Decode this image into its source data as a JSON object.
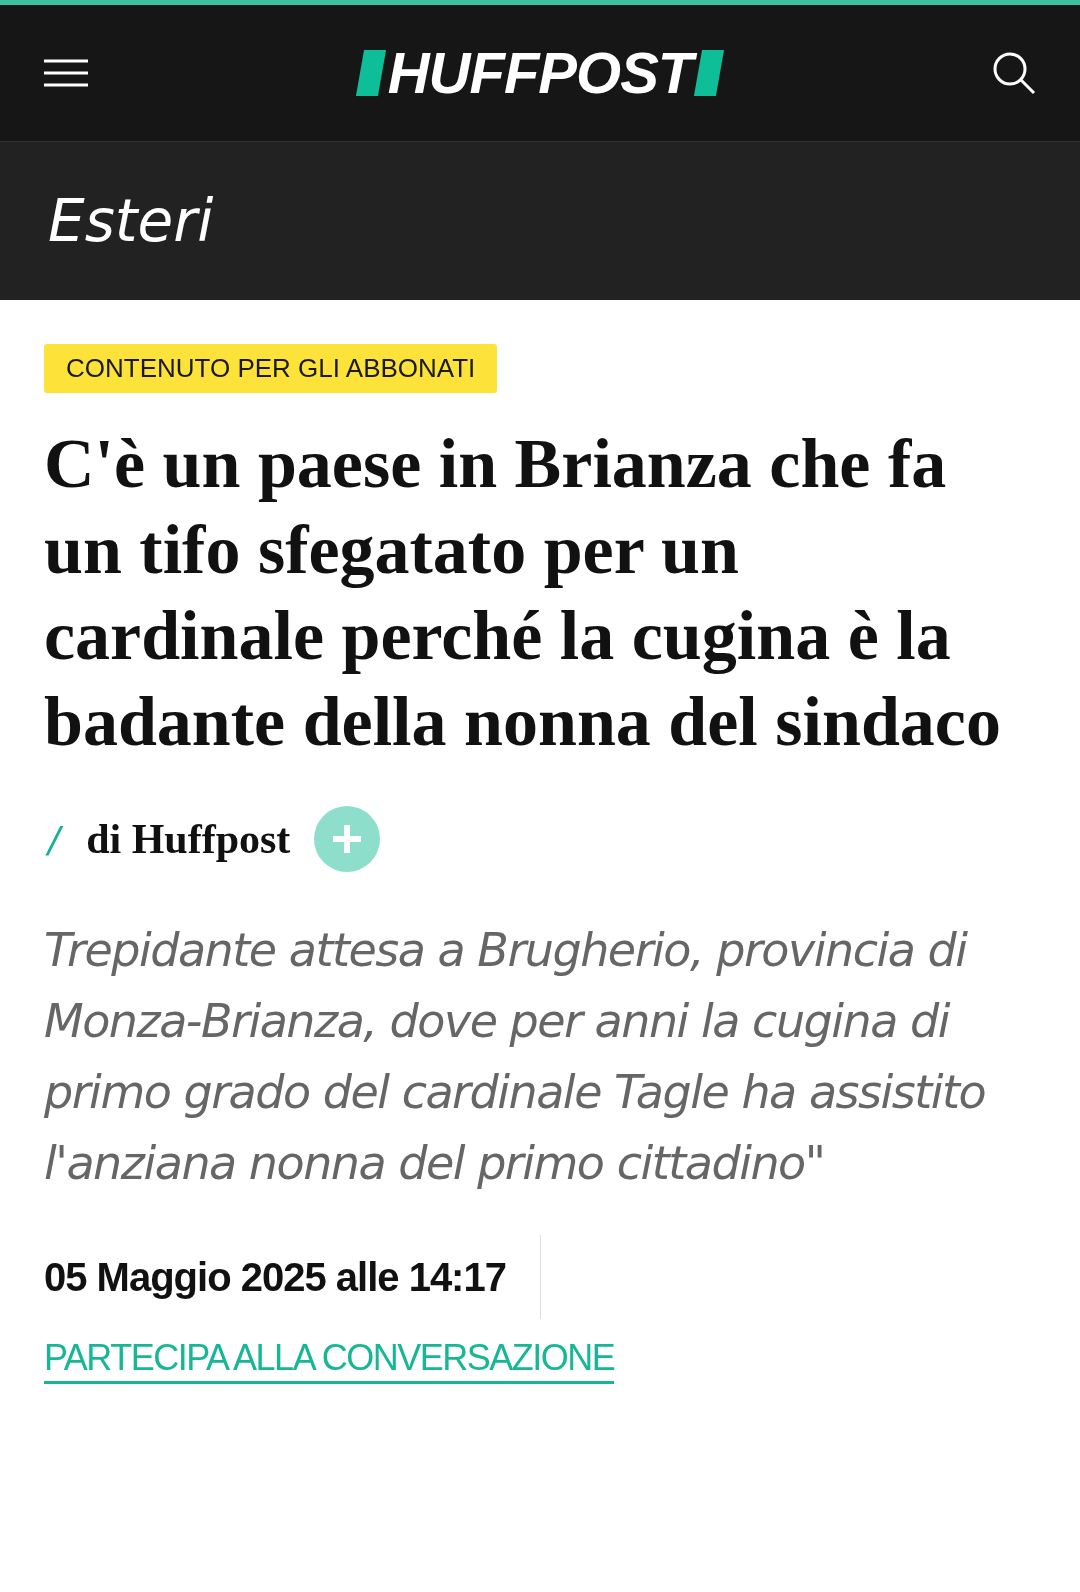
{
  "header": {
    "logo": "HUFFPOST"
  },
  "section": {
    "title": "Esteri"
  },
  "article": {
    "badge": "CONTENUTO PER GLI ABBONATI",
    "headline": "C'è un paese in Brianza che fa un tifo sfegatato per un cardinale perché la cugina è la badante della nonna del sindaco",
    "byline": {
      "separator": "/",
      "author": "di Huffpost"
    },
    "deck": "Trepidante attesa a Brugherio, provincia di Monza-Brianza, dove per anni la cugina di primo grado del cardinale Tagle ha assistito l'anziana nonna del primo cittadino\"",
    "date": "05 Maggio 2025 alle 14:17",
    "link": "PARTECIPA ALLA CONVERSAZIONE"
  }
}
